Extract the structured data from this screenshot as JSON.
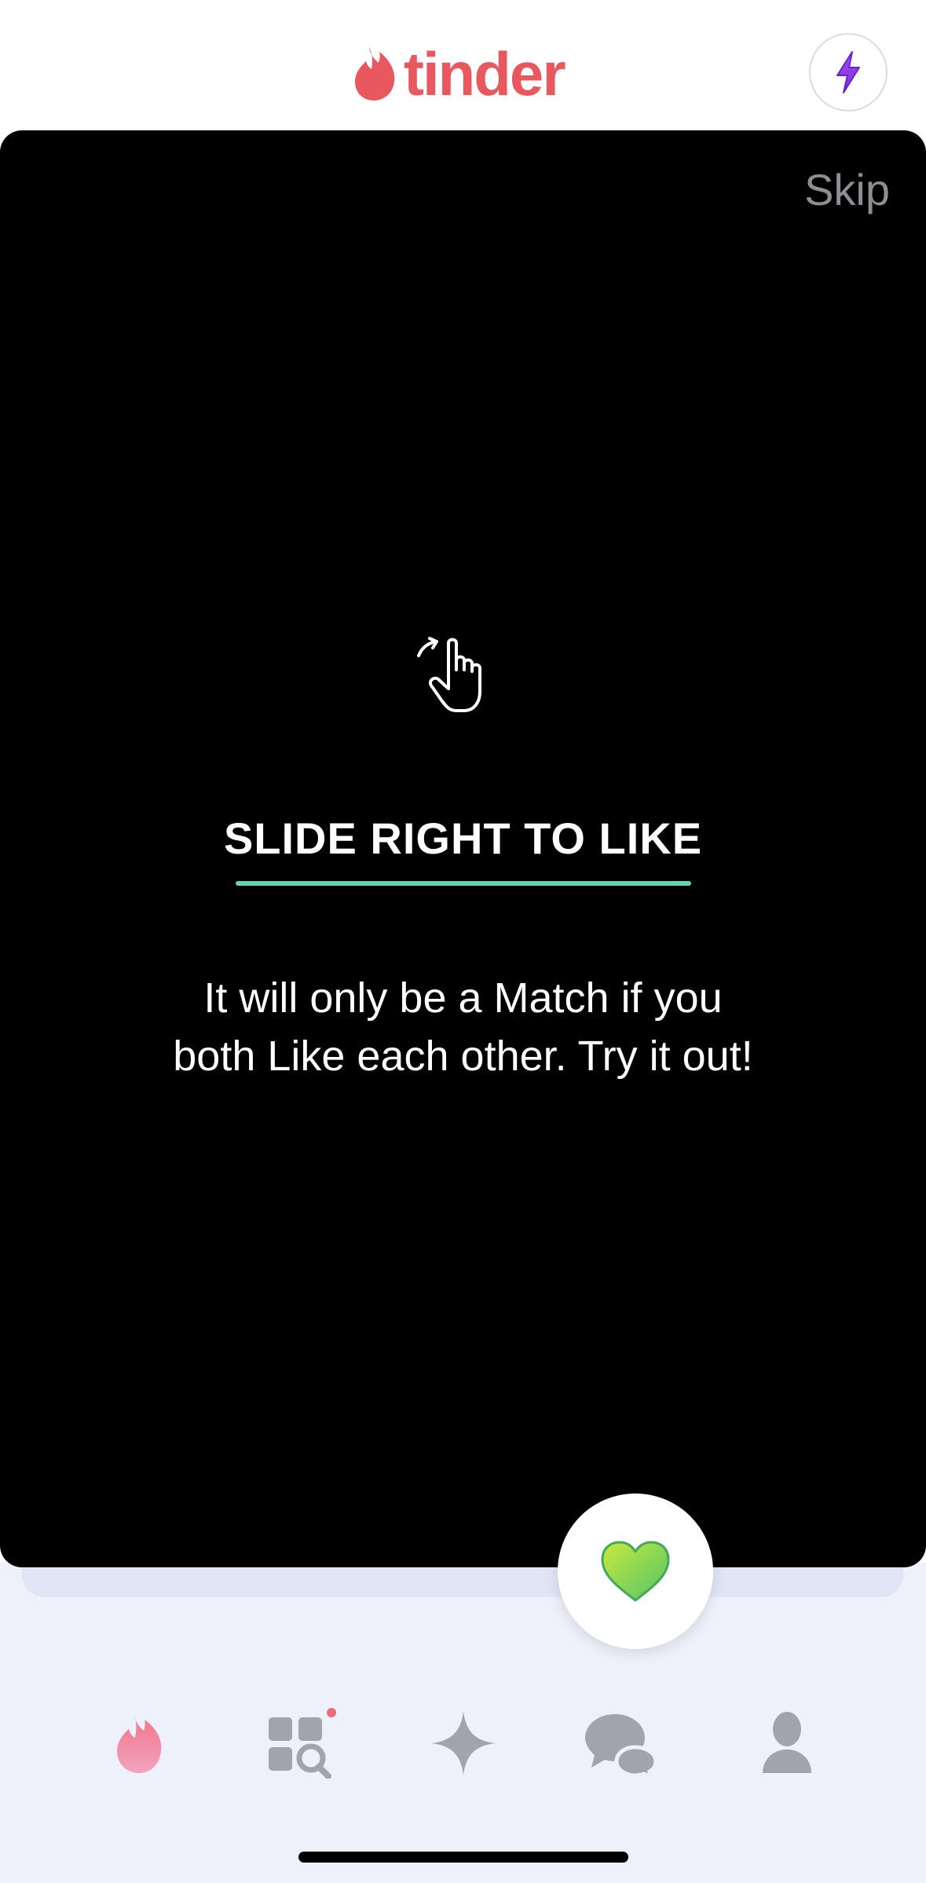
{
  "header": {
    "logo_text": "tinder",
    "brand_color": "#e8585f",
    "boost_icon": "lightning-bolt-icon"
  },
  "card": {
    "skip_label": "Skip",
    "gesture_icon": "swipe-hand-icon",
    "title": "SLIDE RIGHT TO LIKE",
    "underline_color": "#61d6b2",
    "message_line1": "It will only be a Match if you",
    "message_line2": "both Like each other. Try it out!"
  },
  "like_button": {
    "icon": "heart-icon",
    "color": "#8bd64e"
  },
  "nav": {
    "items": [
      {
        "icon": "flame-icon",
        "active": true
      },
      {
        "icon": "explore-grid-icon",
        "badge": true
      },
      {
        "icon": "sparkle-icon"
      },
      {
        "icon": "chat-bubbles-icon"
      },
      {
        "icon": "profile-icon"
      }
    ]
  }
}
